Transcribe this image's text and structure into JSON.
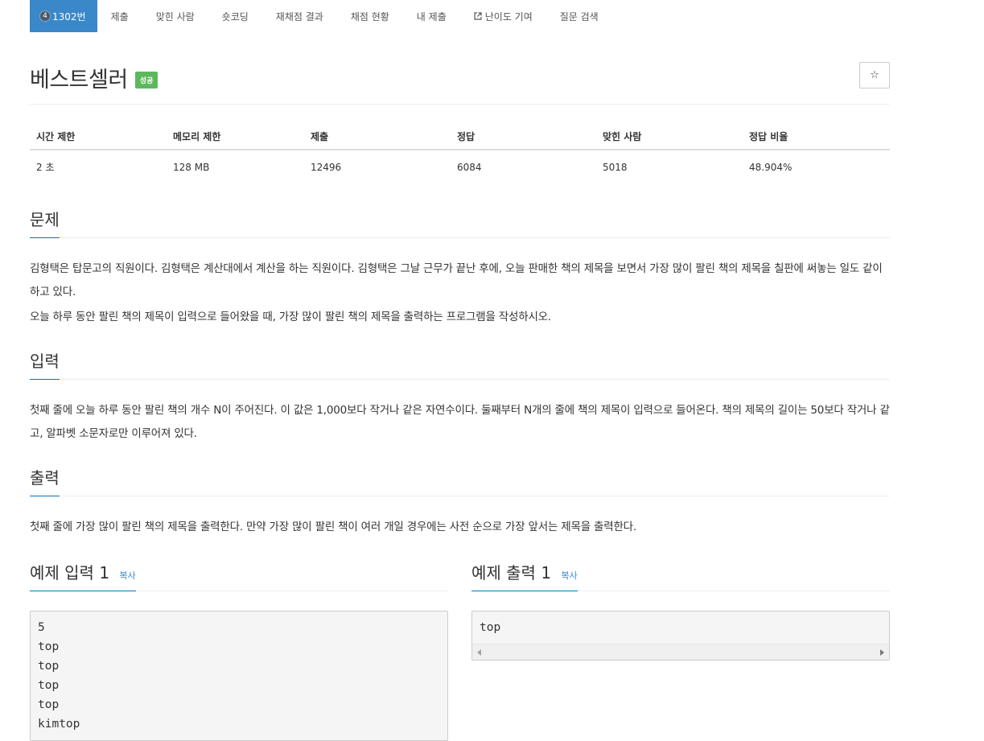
{
  "nav": {
    "problem_tab": {
      "badge": "4",
      "label": "1302번"
    },
    "items": [
      "제출",
      "맞힌 사람",
      "숏코딩",
      "재채점 결과",
      "채점 현황",
      "내 제출",
      "난이도 기여",
      "질문 검색"
    ]
  },
  "header": {
    "title": "베스트셀러",
    "status_label": "성공",
    "star_icon": "☆"
  },
  "info_table": {
    "headers": [
      "시간 제한",
      "메모리 제한",
      "제출",
      "정답",
      "맞힌 사람",
      "정답 비율"
    ],
    "values": [
      "2 초",
      "128 MB",
      "12496",
      "6084",
      "5018",
      "48.904%"
    ]
  },
  "sections": {
    "problem": {
      "title": "문제",
      "paragraphs": [
        "김형택은 탑문고의 직원이다. 김형택은 계산대에서 계산을 하는 직원이다. 김형택은 그날 근무가 끝난 후에, 오늘 판매한 책의 제목을 보면서 가장 많이 팔린 책의 제목을 칠판에 써놓는 일도 같이 하고 있다.",
        "오늘 하루 동안 팔린 책의 제목이 입력으로 들어왔을 때, 가장 많이 팔린 책의 제목을 출력하는 프로그램을 작성하시오."
      ]
    },
    "input": {
      "title": "입력",
      "paragraphs": [
        "첫째 줄에 오늘 하루 동안 팔린 책의 개수 N이 주어진다. 이 값은 1,000보다 작거나 같은 자연수이다. 둘째부터 N개의 줄에 책의 제목이 입력으로 들어온다. 책의 제목의 길이는 50보다 작거나 같고, 알파벳 소문자로만 이루어져 있다."
      ]
    },
    "output": {
      "title": "출력",
      "paragraphs": [
        "첫째 줄에 가장 많이 팔린 책의 제목을 출력한다. 만약 가장 많이 팔린 책이 여러 개일 경우에는 사전 순으로 가장 앞서는 제목을 출력한다."
      ]
    }
  },
  "samples": {
    "input": {
      "title": "예제 입력 1",
      "copy_label": "복사",
      "lines": [
        "5",
        "top",
        "top",
        "top",
        "top",
        "kimtop"
      ]
    },
    "output": {
      "title": "예제 출력 1",
      "copy_label": "복사",
      "lines": [
        "top"
      ]
    }
  },
  "colors": {
    "active_tab": "#3a87c9",
    "success": "#5cb85c",
    "link": "#3a87c9"
  }
}
